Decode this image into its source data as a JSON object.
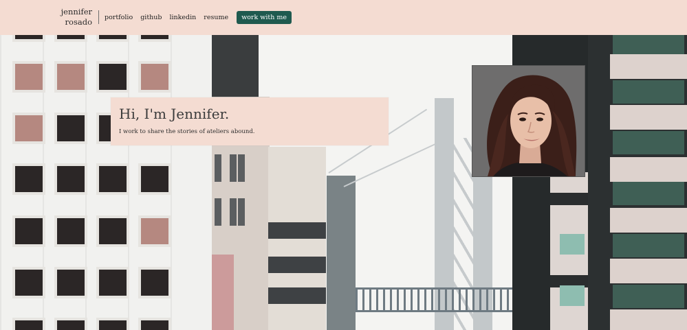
{
  "header": {
    "brand_line1": "jennifer",
    "brand_line2": "rosado",
    "nav": [
      {
        "label": "portfolio"
      },
      {
        "label": "github"
      },
      {
        "label": "linkedin"
      },
      {
        "label": "resume"
      }
    ],
    "cta_label": "work with me"
  },
  "hero": {
    "title": "Hi, I'm Jennifer.",
    "subtitle": "I work to share the stories of ateliers abound."
  },
  "colors": {
    "header_bg": "#f4dcd2",
    "cta_bg": "#1f5a4f",
    "hero_bg": "#f4dcd2"
  },
  "icons": {
    "portrait": "profile-photo"
  }
}
